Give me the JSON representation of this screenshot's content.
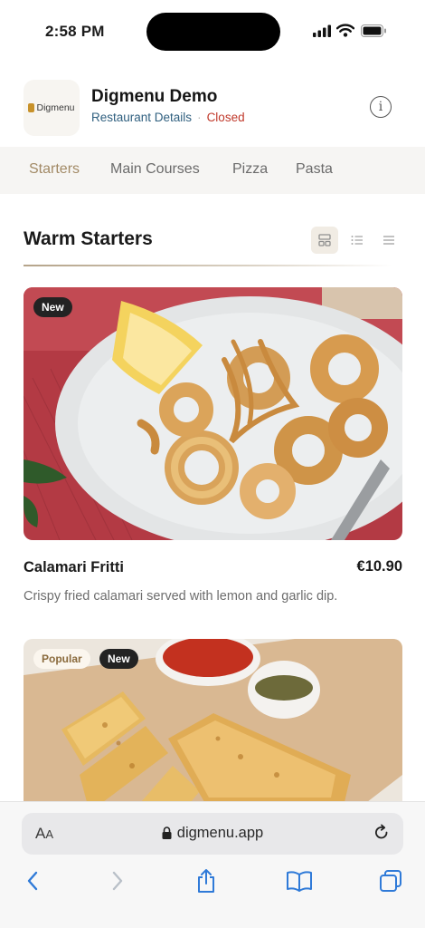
{
  "status_bar": {
    "time": "2:58 PM",
    "icons": [
      "cellular-signal-icon",
      "wifi-icon",
      "battery-icon"
    ]
  },
  "header": {
    "logo_text": "Digmenu",
    "restaurant_name": "Digmenu Demo",
    "details_link": "Restaurant Details",
    "separator": "·",
    "status": "Closed",
    "info_icon": "info-icon"
  },
  "tabs": [
    {
      "label": "Starters",
      "active": true
    },
    {
      "label": "Main Courses",
      "active": false
    },
    {
      "label": "Pizza",
      "active": false
    },
    {
      "label": "Pasta",
      "active": false
    }
  ],
  "section": {
    "title": "Warm Starters",
    "view_modes": [
      "grid-view-icon",
      "list-view-icon",
      "compact-list-icon"
    ],
    "active_view": "grid-view-icon"
  },
  "items": [
    {
      "badges": [
        "New"
      ],
      "name": "Calamari Fritti",
      "price": "€10.90",
      "description": "Crispy fried calamari served with lemon and garlic dip."
    },
    {
      "badges": [
        "Popular",
        "New"
      ]
    }
  ],
  "browser": {
    "text_size_label_big": "A",
    "text_size_label_small": "A",
    "url": "digmenu.app",
    "toolbar": [
      "back-icon",
      "forward-icon",
      "share-icon",
      "bookmarks-icon",
      "tabs-icon"
    ]
  },
  "colors": {
    "accent": "#a28a66",
    "closed": "#c0392b",
    "link": "#2f5f7f",
    "tabs_background": "#f6f5f3",
    "ios_blue": "#2f7ad8"
  }
}
